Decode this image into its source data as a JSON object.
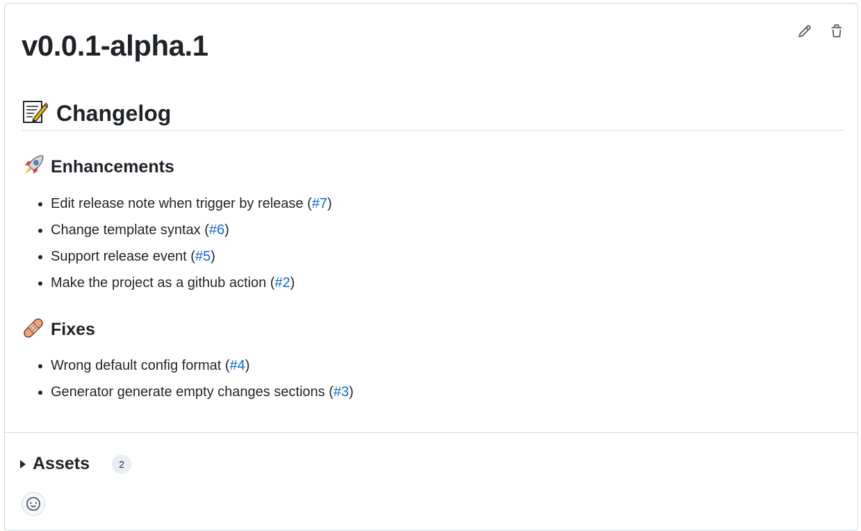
{
  "release": {
    "title": "v0.0.1-alpha.1"
  },
  "actions": [
    {
      "icon": "pencil-icon"
    },
    {
      "icon": "trash-icon"
    }
  ],
  "changelog": {
    "heading": "Changelog",
    "heading_emoji": "📝",
    "sections": [
      {
        "emoji": "🚀",
        "heading": "Enhancements",
        "items": [
          {
            "text": "Edit release note when trigger by release",
            "issue": "#7"
          },
          {
            "text": "Change template syntax",
            "issue": "#6"
          },
          {
            "text": "Support release event",
            "issue": "#5"
          },
          {
            "text": "Make the project as a github action",
            "issue": "#2"
          }
        ]
      },
      {
        "emoji": "🩹",
        "heading": "Fixes",
        "items": [
          {
            "text": "Wrong default config format",
            "issue": "#4"
          },
          {
            "text": "Generator generate empty changes sections",
            "issue": "#3"
          }
        ]
      }
    ]
  },
  "assets": {
    "label": "Assets",
    "count": "2"
  },
  "colors": {
    "link": "#0969da",
    "text": "#1f2328",
    "border": "#d0d7de"
  }
}
